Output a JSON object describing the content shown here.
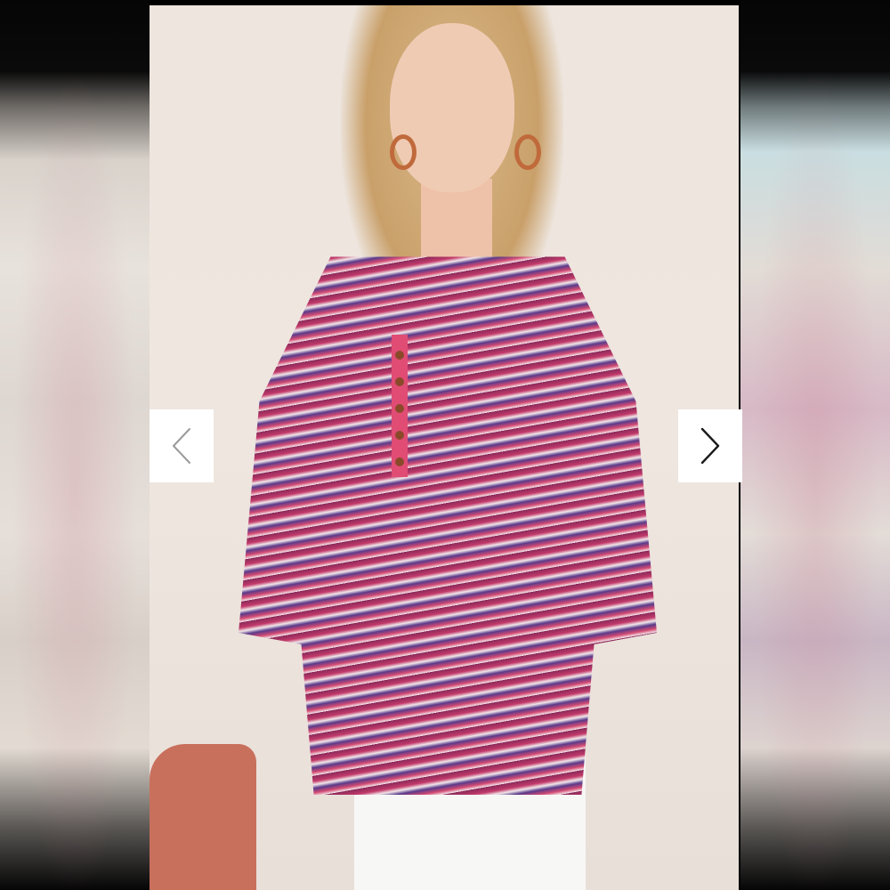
{
  "viewer": {
    "prev_icon": "chevron-left-icon",
    "next_icon": "chevron-right-icon",
    "prev_color": "#9a9a9a",
    "next_color": "#1a1a1a"
  },
  "product_image": {
    "colors": {
      "blouse_primary": "#b33363",
      "blouse_accent": "#5a3a8a",
      "background": "#efe7e0"
    }
  }
}
